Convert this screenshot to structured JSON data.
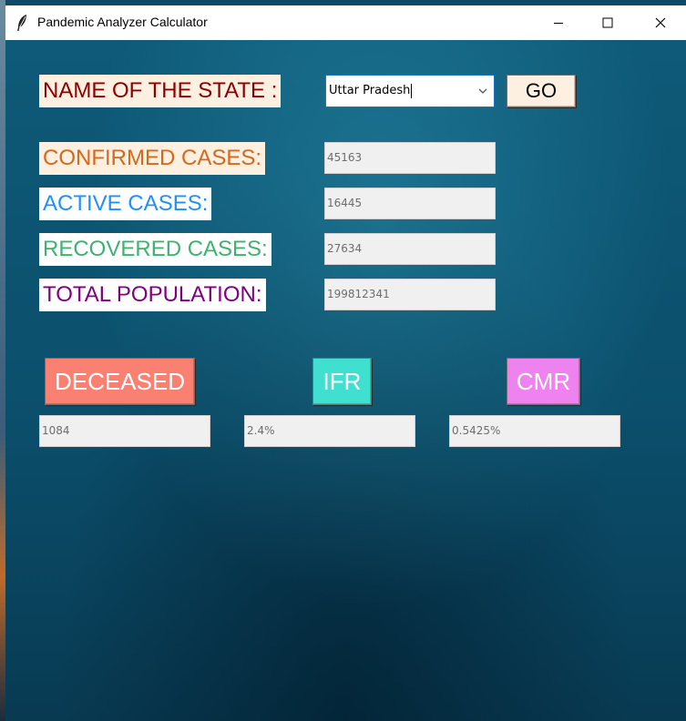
{
  "window": {
    "title": "Pandemic Analyzer Calculator"
  },
  "state_selector": {
    "label": "NAME OF THE STATE :",
    "selected": "Uttar Pradesh",
    "go_label": "GO"
  },
  "stats": {
    "confirmed": {
      "label": "CONFIRMED CASES:",
      "value": "45163"
    },
    "active": {
      "label": "ACTIVE CASES:",
      "value": "16445"
    },
    "recovered": {
      "label": "RECOVERED CASES:",
      "value": "27634"
    },
    "population": {
      "label": "TOTAL POPULATION:",
      "value": "199812341"
    }
  },
  "actions": {
    "deceased": {
      "label": "DECEASED",
      "value": "1084"
    },
    "ifr": {
      "label": "IFR",
      "value": "2.4%"
    },
    "cmr": {
      "label": "CMR",
      "value": "0.5425%"
    }
  },
  "colors": {
    "state_label": "#8b0000",
    "confirmed": "#d2691e",
    "active": "#1e90ff",
    "recovered": "#3cb371",
    "population": "#800080",
    "deceased_btn": "#fa8072",
    "ifr_btn": "#40e0d0",
    "cmr_btn": "#ee82ee",
    "go_btn": "#fdf0e0"
  },
  "icons": {
    "app": "feather-icon",
    "minimize": "minimize-icon",
    "maximize": "maximize-icon",
    "close": "close-icon",
    "dropdown": "chevron-down-icon"
  }
}
